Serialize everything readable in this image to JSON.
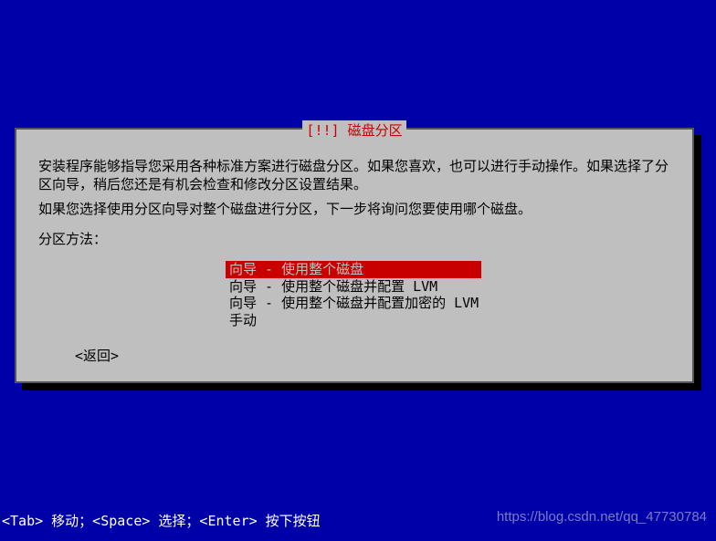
{
  "dialog": {
    "title": "[!!] 磁盘分区",
    "paragraph1": "安装程序能够指导您采用各种标准方案进行磁盘分区。如果您喜欢，也可以进行手动操作。如果选择了分区向导，稍后您还是有机会检查和修改分区设置结果。",
    "paragraph2": "如果您选择使用分区向导对整个磁盘进行分区，下一步将询问您要使用哪个磁盘。",
    "prompt_label": "分区方法：",
    "menu": {
      "selected_index": 0,
      "items": [
        "向导 - 使用整个磁盘",
        "向导 - 使用整个磁盘并配置 LVM",
        "向导 - 使用整个磁盘并配置加密的 LVM",
        "手动"
      ]
    },
    "back_label": "<返回>"
  },
  "footer_help": "<Tab> 移动；<Space> 选择；<Enter> 按下按钮",
  "watermark": "https://blog.csdn.net/qq_47730784"
}
